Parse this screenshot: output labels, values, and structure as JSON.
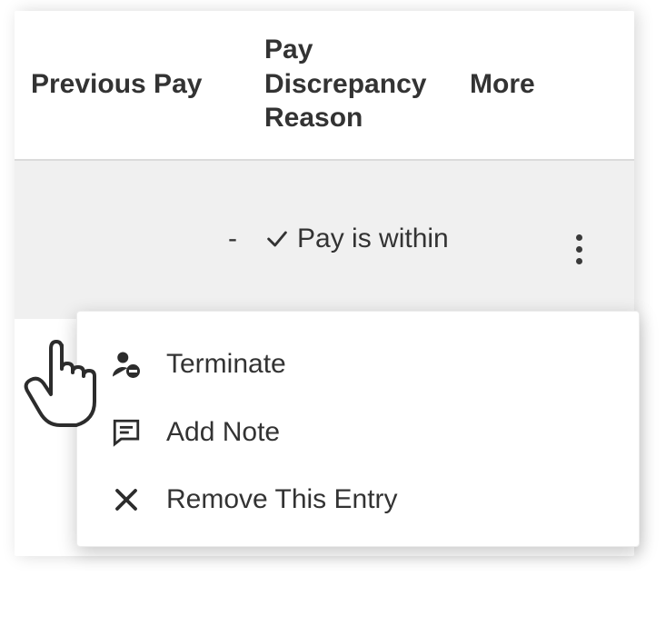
{
  "columns": {
    "previous_pay": "Previous Pay",
    "pay_discrepancy_reason": "Pay Discrepancy Reason",
    "more": "More"
  },
  "row": {
    "previous_pay_value": "-",
    "pay_discrepancy_text": "Pay is within"
  },
  "icons": {
    "check": "check-icon",
    "kebab": "more-options-icon",
    "person_remove": "person-remove-icon",
    "note": "note-icon",
    "close": "close-icon",
    "pointer": "pointer-cursor-icon"
  },
  "menu": {
    "terminate": "Terminate",
    "add_note": "Add Note",
    "remove_entry": "Remove This Entry"
  }
}
